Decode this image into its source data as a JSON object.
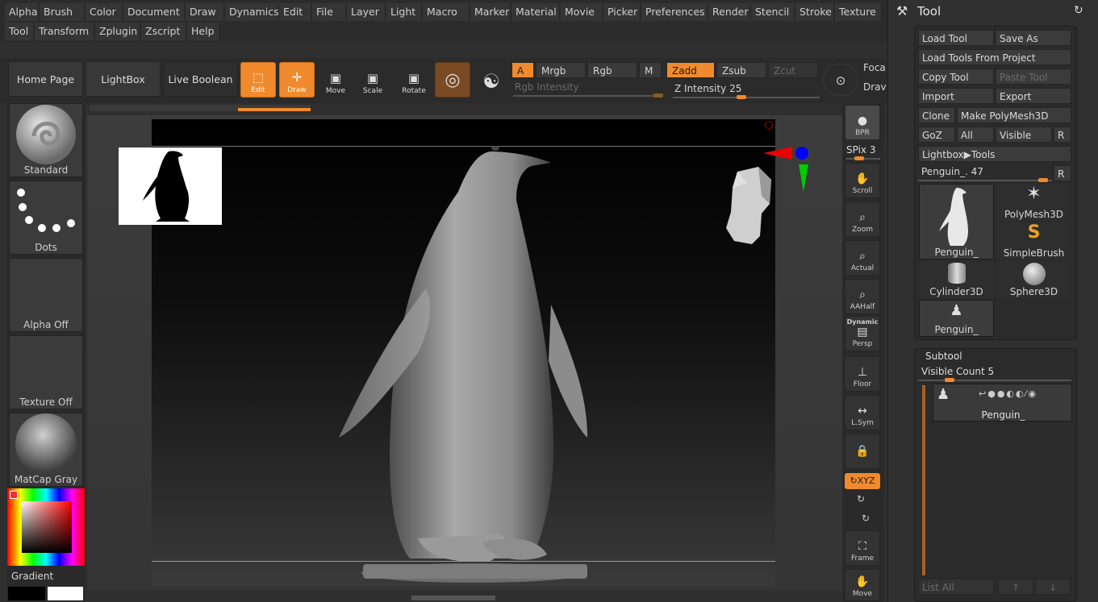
{
  "menu": {
    "row1": [
      "Alpha",
      "Brush",
      "Color",
      "Document",
      "Draw",
      "Dynamics",
      "Edit",
      "File",
      "Layer",
      "Light",
      "Macro",
      "Marker",
      "Material",
      "Movie",
      "Picker",
      "Preferences",
      "Render",
      "Stencil",
      "Stroke",
      "Texture"
    ],
    "row2": [
      "Tool",
      "Transform",
      "Zplugin",
      "Zscript",
      "Help"
    ]
  },
  "toolbar": {
    "home": "Home Page",
    "lightbox": "LightBox",
    "live_boolean": "Live Boolean",
    "edit": "Edit",
    "draw": "Draw",
    "move": "Move",
    "scale": "Scale",
    "rotate": "Rotate",
    "a": "A",
    "mrgb": "Mrgb",
    "rgb": "Rgb",
    "m": "M",
    "zadd": "Zadd",
    "zsub": "Zsub",
    "zcut": "Zcut",
    "rgb_intensity": "Rgb Intensity",
    "z_intensity_label": "Z Intensity",
    "z_intensity_value": "25",
    "focal": "Foca",
    "draw_size": "Drav"
  },
  "left_shelf": {
    "brush": "Standard",
    "stroke": "Dots",
    "alpha": "Alpha Off",
    "texture": "Texture Off",
    "material": "MatCap Gray",
    "gradient": "Gradient"
  },
  "right_shelf": {
    "bpr": "BPR",
    "spix_label": "SPix",
    "spix_value": "3",
    "scroll": "Scroll",
    "zoom": "Zoom",
    "actual": "Actual",
    "aahalf": "AAHalf",
    "dynamic": "Dynamic",
    "persp": "Persp",
    "floor": "Floor",
    "lsym": "L.Sym",
    "xyz": "XYZ",
    "frame": "Frame",
    "move": "Move"
  },
  "tool_panel": {
    "title": "Tool",
    "load_tool": "Load Tool",
    "save_as": "Save As",
    "load_from_project": "Load Tools From Project",
    "copy_tool": "Copy Tool",
    "paste_tool": "Paste Tool",
    "import": "Import",
    "export": "Export",
    "clone": "Clone",
    "make_polymesh": "Make PolyMesh3D",
    "goz": "GoZ",
    "all": "All",
    "visible": "Visible",
    "r": "R",
    "lightbox_tools": "Lightbox▶Tools",
    "current_tool_label": "Penguin_.",
    "current_tool_value": "47",
    "tools": [
      "Penguin_",
      "PolyMesh3D",
      "SimpleBrush",
      "Cylinder3D",
      "Sphere3D",
      "Penguin_"
    ]
  },
  "subtool": {
    "title": "Subtool",
    "visible_count_label": "Visible Count",
    "visible_count_value": "5",
    "item": "Penguin_",
    "list_all": "List All"
  },
  "colors": {
    "accent": "#f08a2c",
    "panel": "#303030",
    "canvas": "#000000"
  }
}
